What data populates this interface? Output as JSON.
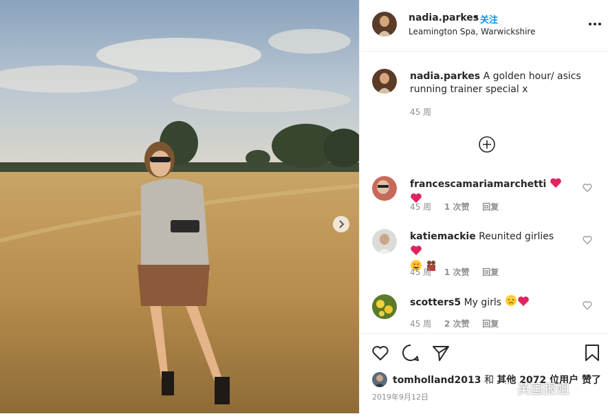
{
  "post": {
    "username": "nadia.parkes",
    "separator": "•",
    "follow_label": "关注",
    "location": "Leamington Spa, Warwickshire",
    "caption_text": "A golden hour/ asics running trainer special x",
    "caption_time": "45 周"
  },
  "comments": [
    {
      "username": "francescamariamarchetti",
      "text": "",
      "time": "45 周",
      "likes": "1 次赞",
      "reply": "回复"
    },
    {
      "username": "katiemackie",
      "text": "Reunited girlies",
      "time": "45 周",
      "likes": "1 次赞",
      "reply": "回复"
    },
    {
      "username": "scotters5",
      "text": "My girls",
      "time": "45 周",
      "likes": "2 次赞",
      "reply": "回复"
    }
  ],
  "likes_summary": {
    "username": "tomholland2013",
    "connector": "和",
    "rest": "其他 2072 位用户 赞了"
  },
  "date": "2019年9月12日",
  "watermark": "英国报姐",
  "colors": {
    "accent": "#0095f6",
    "heart": "#ed4956",
    "muted": "#8e8e8e"
  },
  "icons": [
    "more-icon",
    "load-more-icon",
    "heart-icon",
    "comment-icon",
    "share-icon",
    "bookmark-icon",
    "chevron-right-icon"
  ]
}
